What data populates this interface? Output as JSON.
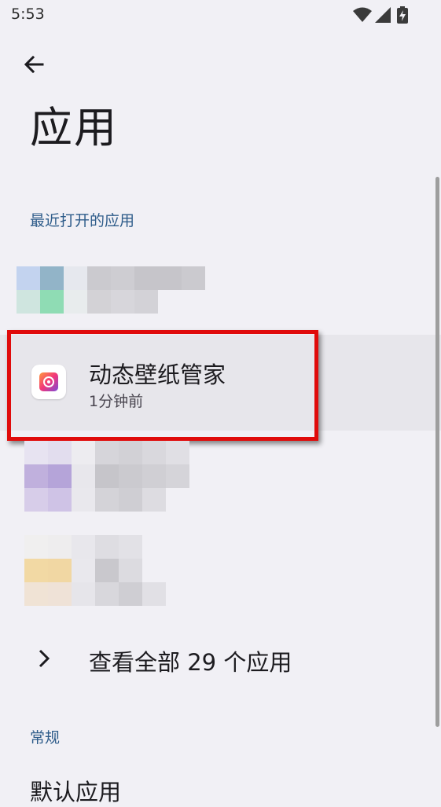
{
  "status_bar": {
    "time": "5:53",
    "icons": [
      "wifi-icon",
      "signal-icon",
      "battery-charging-icon"
    ]
  },
  "header": {
    "back_icon": "arrow-left-icon",
    "title": "应用"
  },
  "recent": {
    "section_label": "最近打开的应用",
    "highlighted_app": {
      "name": "动态壁纸管家",
      "subtitle": "1分钟前",
      "icon": "wallpaper-app-icon"
    }
  },
  "see_all": {
    "label": "查看全部 29 个应用",
    "icon": "chevron-right-icon"
  },
  "general": {
    "section_label": "常规",
    "first_item_label": "默认应用"
  },
  "colors": {
    "background": "#f1f0f5",
    "accent": "#2e5c8a",
    "highlight_border": "#e00b0b"
  }
}
